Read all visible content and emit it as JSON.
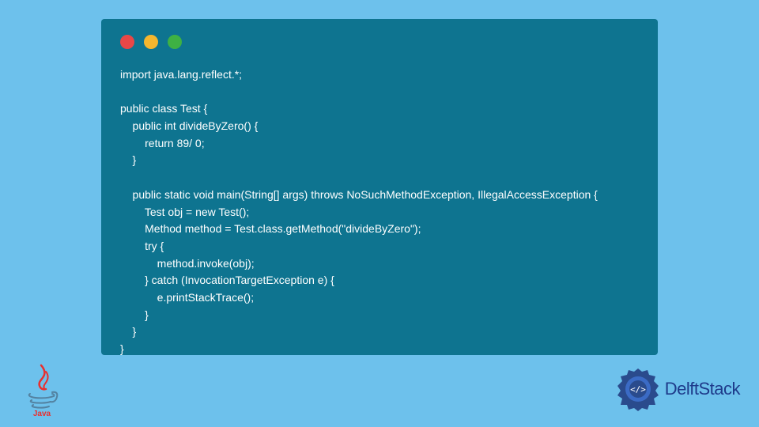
{
  "code": {
    "lines": [
      "import java.lang.reflect.*;",
      "",
      "public class Test {",
      "    public int divideByZero() {",
      "        return 89/ 0;",
      "    }",
      "",
      "    public static void main(String[] args) throws NoSuchMethodException, IllegalAccessException {",
      "        Test obj = new Test();",
      "        Method method = Test.class.getMethod(\"divideByZero\");",
      "        try {",
      "            method.invoke(obj);",
      "        } catch (InvocationTargetException e) {",
      "            e.printStackTrace();",
      "        }",
      "    }",
      "}"
    ]
  },
  "logos": {
    "java_label": "Java",
    "delft_label": "DelftStack"
  },
  "colors": {
    "bg": "#6dc1ec",
    "window": "#0e7490",
    "red": "#e84747",
    "yellow": "#f5b62e",
    "green": "#3eb143",
    "delft_blue": "#1e3a8a"
  }
}
